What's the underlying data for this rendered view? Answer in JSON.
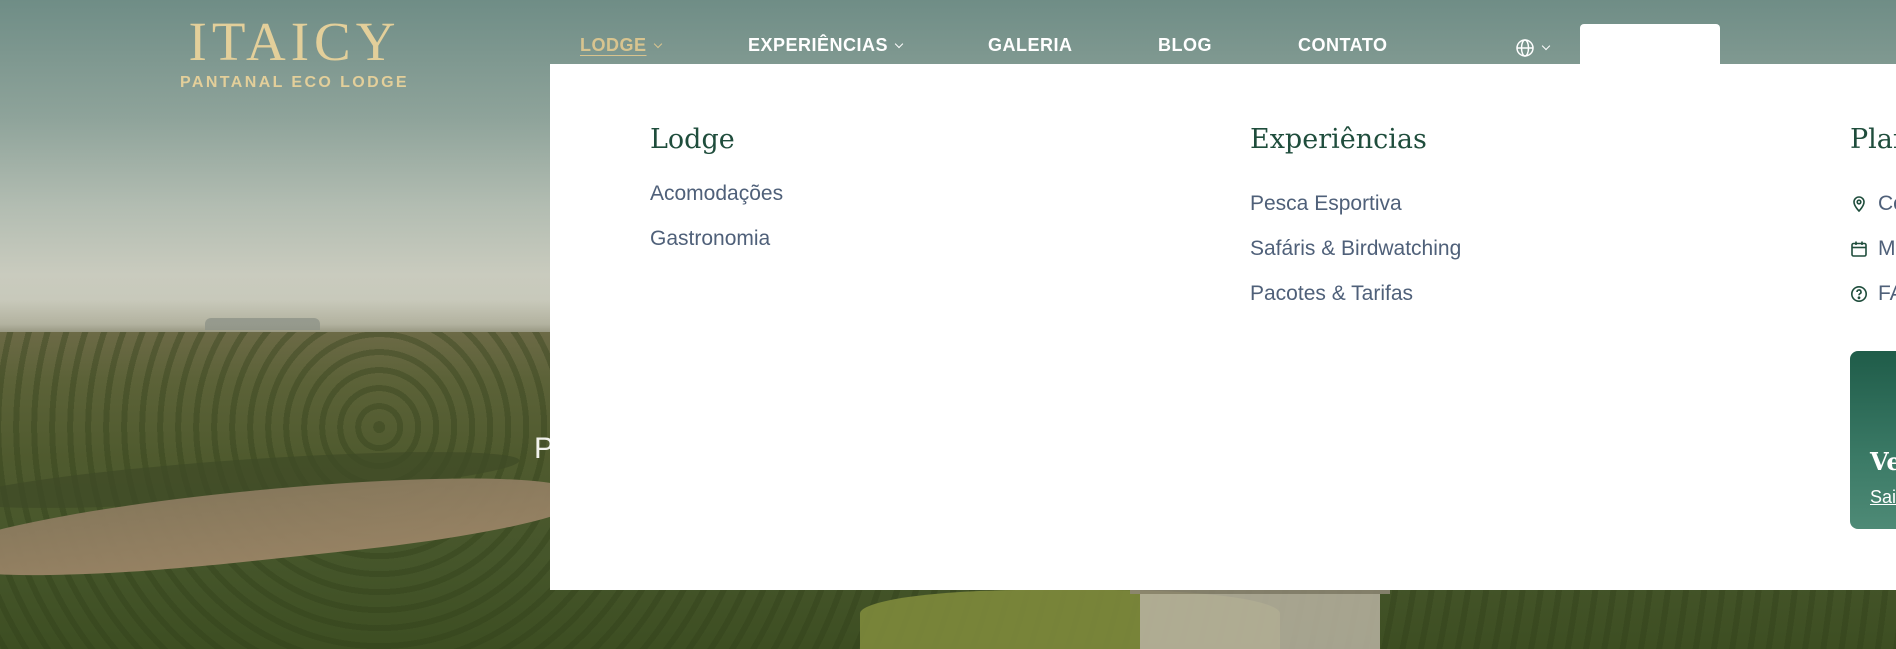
{
  "brand": {
    "logo_main": "ITAICY",
    "logo_sub": "PANTANAL ECO LODGE",
    "gold_color": "#e3cf9a"
  },
  "nav": {
    "items": [
      {
        "label": "LODGE",
        "has_dropdown": true,
        "active": true
      },
      {
        "label": "EXPERIÊNCIAS",
        "has_dropdown": true,
        "active": false
      },
      {
        "label": "GALERIA",
        "has_dropdown": false,
        "active": false
      },
      {
        "label": "BLOG",
        "has_dropdown": false,
        "active": false
      },
      {
        "label": "CONTATO",
        "has_dropdown": false,
        "active": false
      }
    ],
    "language_icon": "globe-icon"
  },
  "hero": {
    "text_fragment": "P"
  },
  "mega_menu": {
    "lodge": {
      "heading": "Lodge",
      "links": [
        "Acomodações",
        "Gastronomia"
      ]
    },
    "experiencias": {
      "heading": "Experiências",
      "links": [
        "Pesca Esportiva",
        "Safáris & Birdwatching",
        "Pacotes & Tarifas"
      ]
    },
    "plan": {
      "heading": "Plan",
      "links": [
        {
          "label": "Co",
          "icon": "map-pin-icon"
        },
        {
          "label": "M",
          "icon": "calendar-icon"
        },
        {
          "label": "FA",
          "icon": "help-circle-icon"
        }
      ]
    },
    "promo": {
      "title": "Ve",
      "link": "Sai"
    },
    "heading_color": "#1f4d3c",
    "link_color": "#4f6079"
  }
}
